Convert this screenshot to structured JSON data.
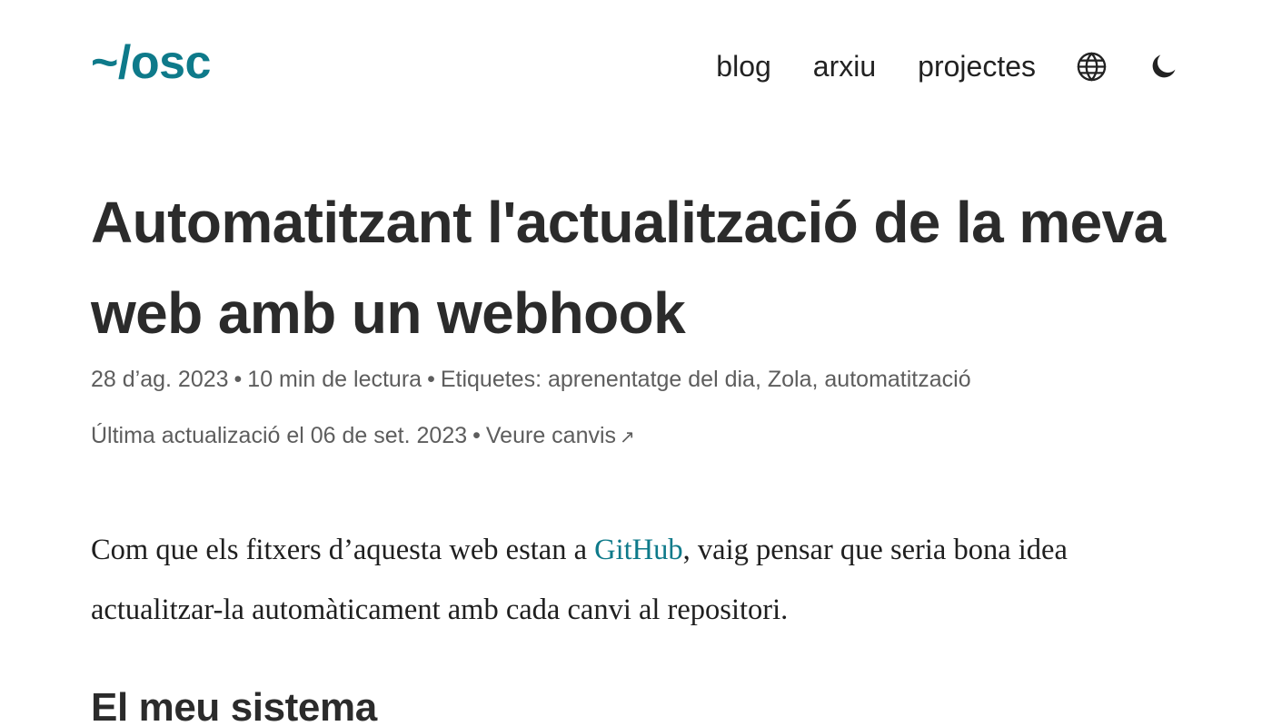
{
  "colors": {
    "accent": "#0e7a8a",
    "text": "#2b2b2b",
    "meta": "#5d5d5d"
  },
  "header": {
    "logo": "~/osc",
    "nav": {
      "blog": "blog",
      "archive": "arxiu",
      "projects": "projectes"
    },
    "icons": [
      "globe-icon",
      "moon-icon"
    ]
  },
  "post": {
    "title": "Automatitzant l'actualització de la meva web amb un webhook",
    "meta": {
      "date": "28 d’ag. 2023",
      "separator": "•",
      "reading_time": "10 min de lectura",
      "tags_label": "Etiquetes:",
      "tags": [
        "aprenentatge del dia",
        "Zola",
        "automatització"
      ],
      "updated": "Última actualizació el 06 de set. 2023",
      "changes_link": "Veure canvis",
      "changes_arrow": "↗"
    },
    "intro": {
      "before_link": "Com que els fitxers d’aquesta web estan a ",
      "link": "GitHub",
      "after_link": ", vaig pensar que seria bona idea actualitzar-la automàticament amb cada canvi al repositori."
    },
    "section_heading": "El meu sistema"
  }
}
